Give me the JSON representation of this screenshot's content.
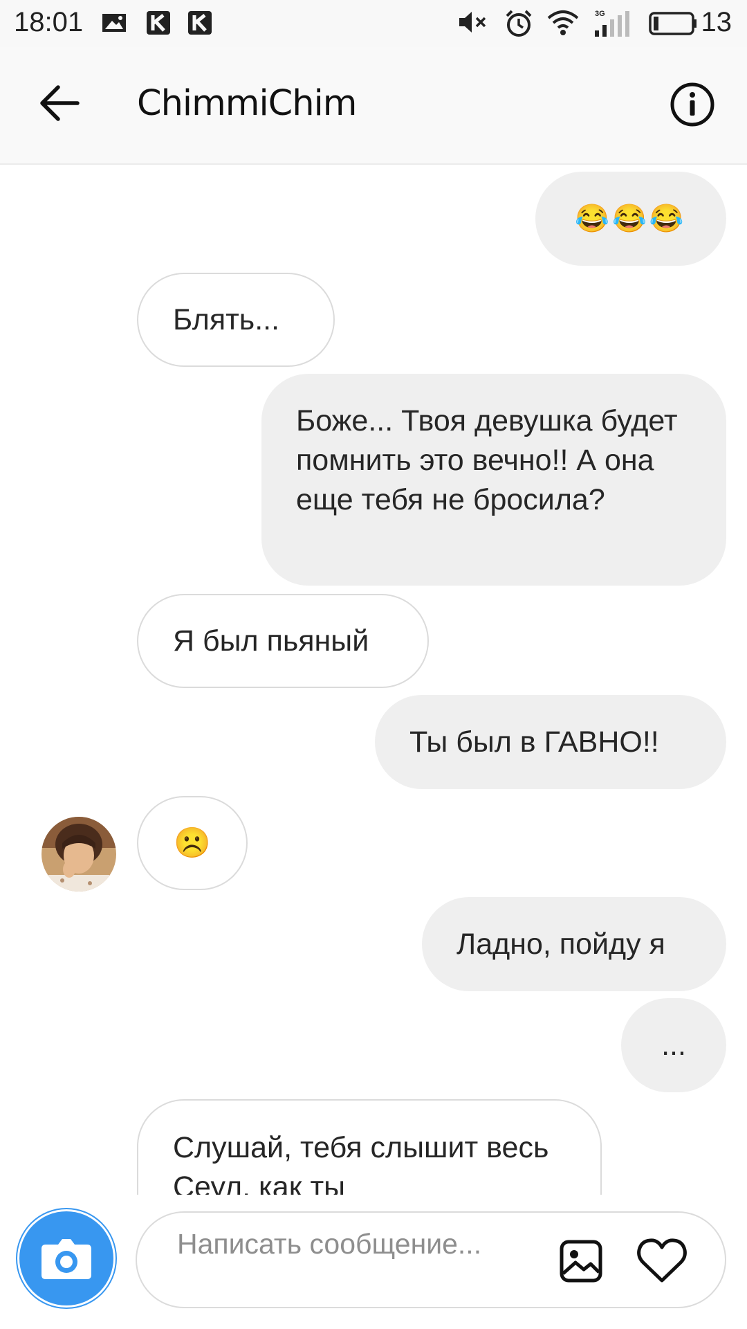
{
  "status_bar": {
    "time": "18:01",
    "network": "3G",
    "battery_level": "13"
  },
  "header": {
    "title": "ChimmiChim"
  },
  "messages": [
    {
      "direction": "outgoing",
      "text": "😂😂😂"
    },
    {
      "direction": "incoming",
      "text": "Блять..."
    },
    {
      "direction": "outgoing",
      "text": "Боже... Твоя девушка будет помнить это вечно!! А она еще тебя не бросила?"
    },
    {
      "direction": "incoming",
      "text": "Я был пьяный"
    },
    {
      "direction": "outgoing",
      "text": "Ты был в ГАВНО!!"
    },
    {
      "direction": "incoming",
      "text": "☹️"
    },
    {
      "direction": "outgoing",
      "text": "Ладно, пойду я"
    },
    {
      "direction": "outgoing",
      "text": "..."
    },
    {
      "direction": "incoming",
      "text": "Слушай, тебя слышит весь Сеул, как ты"
    }
  ],
  "composer": {
    "placeholder": "Написать сообщение..."
  },
  "colors": {
    "accent": "#3897f0",
    "outgoing_bubble": "#efefef",
    "incoming_border": "#dbdbdb"
  }
}
